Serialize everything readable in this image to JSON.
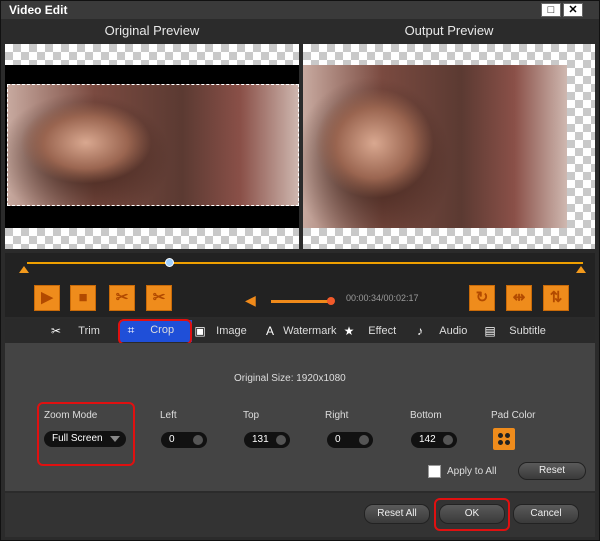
{
  "window": {
    "title": "Video Edit",
    "restore_glyph": "□",
    "close_glyph": "✕"
  },
  "headers": {
    "original": "Original Preview",
    "output": "Output Preview"
  },
  "playback": {
    "time": "00:00:34/00:02:17",
    "progress_fraction": 0.25,
    "volume_fraction": 0.9,
    "buttons": [
      {
        "name": "play",
        "icon": "play-icon",
        "glyph": "▶"
      },
      {
        "name": "stop",
        "icon": "stop-icon",
        "glyph": "■"
      },
      {
        "name": "cut",
        "icon": "scissors-icon",
        "glyph": "✂"
      },
      {
        "name": "split",
        "icon": "split-icon",
        "glyph": "✂"
      }
    ],
    "right_buttons": [
      {
        "name": "rotate",
        "icon": "rotate-icon",
        "glyph": "↻"
      },
      {
        "name": "flip-horizontal",
        "icon": "flip-horizontal-icon",
        "glyph": "⇹"
      },
      {
        "name": "flip-vertical",
        "icon": "flip-vertical-icon",
        "glyph": "⇅"
      }
    ]
  },
  "tabs": [
    {
      "label": "Trim",
      "icon": "scissors-icon",
      "glyph": "✂"
    },
    {
      "label": "Crop",
      "icon": "crop-icon",
      "glyph": "⌗"
    },
    {
      "label": "Image",
      "icon": "image-icon",
      "glyph": "▣"
    },
    {
      "label": "Watermark",
      "icon": "watermark-icon",
      "glyph": "A"
    },
    {
      "label": "Effect",
      "icon": "star-icon",
      "glyph": "★"
    },
    {
      "label": "Audio",
      "icon": "music-note-icon",
      "glyph": "♪"
    },
    {
      "label": "Subtitle",
      "icon": "subtitle-icon",
      "glyph": "▤"
    }
  ],
  "active_tab": "Crop",
  "crop": {
    "original_size": "Original Size: 1920x1080",
    "zoom_mode_label": "Zoom Mode",
    "zoom_mode_value": "Full Screen",
    "left_label": "Left",
    "left_value": "0",
    "top_label": "Top",
    "top_value": "131",
    "right_label": "Right",
    "right_value": "0",
    "bottom_label": "Bottom",
    "bottom_value": "142",
    "pad_color_label": "Pad Color",
    "apply_to_all": "Apply to All",
    "reset": "Reset"
  },
  "footer": {
    "reset_all": "Reset All",
    "ok": "OK",
    "cancel": "Cancel"
  },
  "colors": {
    "accent": "#ef8c1c",
    "highlight": "#e01010",
    "tab_active": "#1f4fd8"
  }
}
